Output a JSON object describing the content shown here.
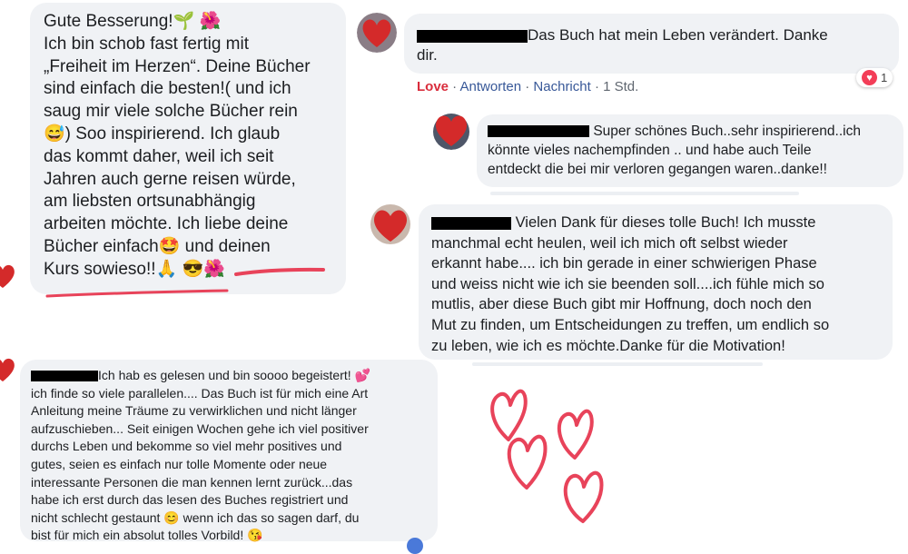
{
  "comment_left": {
    "line1": "Gute Besserung!🌱 🌺",
    "line2": "Ich bin schob fast fertig mit",
    "line3": "„Freiheit im Herzen“. Deine Bücher",
    "line4": "sind einfach die besten!( und ich",
    "line5": "saug mir viele solche Bücher rein",
    "line6": "😅) Soo inspirierend. Ich glaub",
    "line7": "das kommt daher, weil ich seit",
    "line8": "Jahren auch gerne reisen würde,",
    "line9": "am liebsten ortsunabhängig",
    "line10": "arbeiten möchte. Ich liebe deine",
    "line11": "Bücher einfach🤩 und deinen",
    "line12": "Kurs sowieso!!🙏 😎🌺"
  },
  "comment_1": {
    "text_a": "Das Buch hat mein Leben verändert. Danke",
    "text_b": "dir.",
    "actions": {
      "love": "Love",
      "sep1": " · ",
      "reply": "Antworten",
      "sep2": " · ",
      "message": "Nachricht",
      "time": " · 1 Std."
    },
    "reaction_count": "1"
  },
  "comment_2": {
    "line1": "Super schönes Buch..sehr inspirierend..ich",
    "line2": "könnte vieles nachempfinden .. und habe auch Teile",
    "line3": "entdeckt die bei mir verloren gegangen waren..danke!!"
  },
  "comment_3": {
    "line1": "Vielen Dank für dieses tolle Buch! Ich musste",
    "line2": "manchmal echt heulen, weil ich mich oft selbst wieder",
    "line3": "erkannt habe.... ich bin gerade in einer schwierigen Phase",
    "line4": "und weiss nicht wie ich sie beenden soll....ich fühle mich so",
    "line5": "mutlis, aber diese Buch gibt mir Hoffnung, doch noch den",
    "line6": "Mut zu finden, um Entscheidungen zu treffen, um endlich so",
    "line7": "zu leben, wie ich es möchte.Danke für die Motivation!"
  },
  "comment_4": {
    "line1": "Ich hab es gelesen und bin soooo begeistert! 💕",
    "line2": "ich finde so viele parallelen.... Das Buch ist für mich eine Art",
    "line3": "Anleitung meine Träume zu verwirklichen und nicht länger",
    "line4": "aufzuschieben... Seit einigen Wochen gehe ich viel positiver",
    "line5": "durchs Leben und bekomme so viel mehr positives und",
    "line6": "gutes, seien es einfach nur tolle Momente oder neue",
    "line7": "interessante Personen die man kennen lernt zurück...das",
    "line8": "habe ich erst durch das lesen des Buches registriert und",
    "line9": "nicht schlecht gestaunt 😊 wenn ich das so sagen darf, du",
    "line10": "bist für mich ein absolut tolles Vorbild! 😘"
  },
  "colors": {
    "bubble": "#f0f2f5",
    "heart": "#d42a2a",
    "doodle": "#e8435a",
    "love": "#d92d3c",
    "link": "#385898"
  }
}
